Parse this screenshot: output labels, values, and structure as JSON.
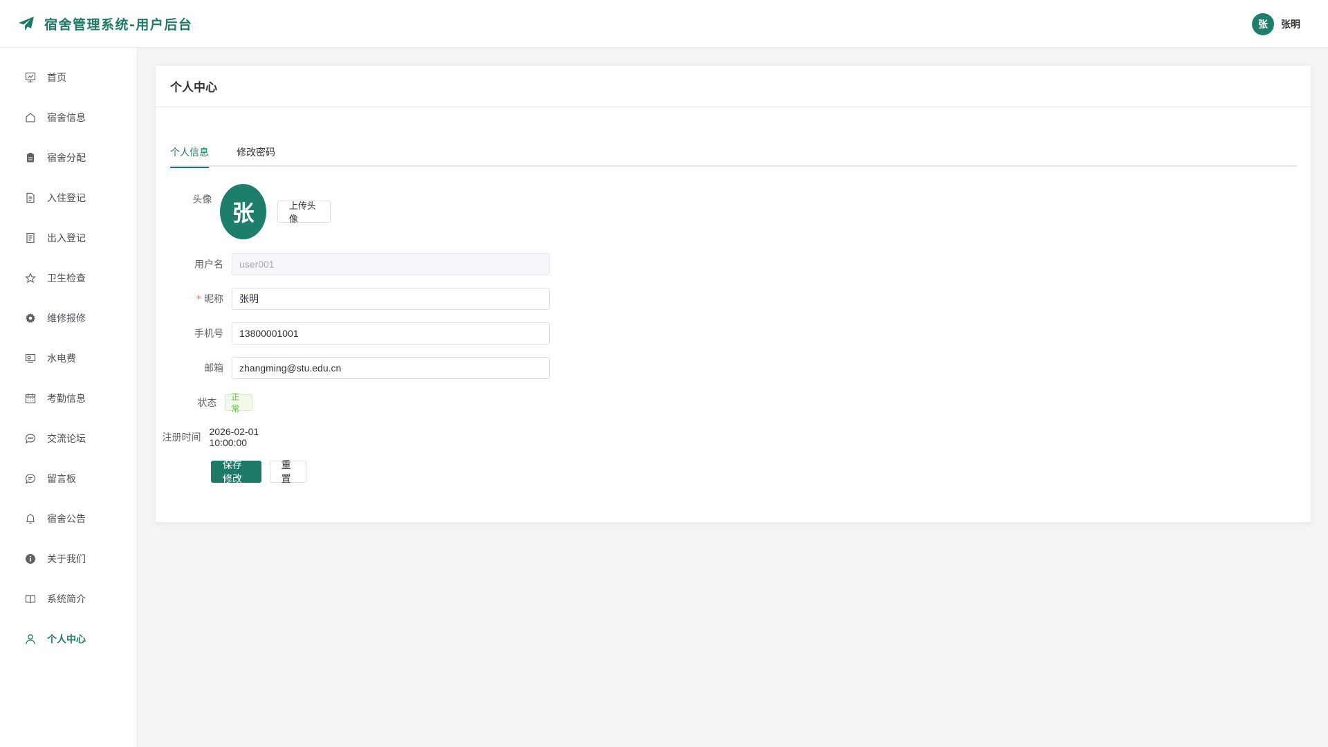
{
  "header": {
    "title": "宿舍管理系统-用户后台",
    "logo_icon": "paper-plane-icon",
    "user_avatar_char": "张",
    "user_name": "张明"
  },
  "sidebar": {
    "items": [
      {
        "label": "首页",
        "icon": "chart-icon"
      },
      {
        "label": "宿舍信息",
        "icon": "home-icon"
      },
      {
        "label": "宿舍分配",
        "icon": "clipboard-icon"
      },
      {
        "label": "入住登记",
        "icon": "document-icon"
      },
      {
        "label": "出入登记",
        "icon": "notes-icon"
      },
      {
        "label": "卫生检查",
        "icon": "star-icon"
      },
      {
        "label": "维修报修",
        "icon": "gear-icon"
      },
      {
        "label": "水电费",
        "icon": "money-icon"
      },
      {
        "label": "考勤信息",
        "icon": "calendar-icon"
      },
      {
        "label": "交流论坛",
        "icon": "chat-icon"
      },
      {
        "label": "留言板",
        "icon": "message-icon"
      },
      {
        "label": "宿舍公告",
        "icon": "bell-icon"
      },
      {
        "label": "关于我们",
        "icon": "info-icon"
      },
      {
        "label": "系统简介",
        "icon": "book-icon"
      },
      {
        "label": "个人中心",
        "icon": "user-icon",
        "active": true
      }
    ]
  },
  "main": {
    "card_title": "个人中心",
    "tabs": [
      {
        "label": "个人信息",
        "active": true
      },
      {
        "label": "修改密码",
        "active": false
      }
    ],
    "form": {
      "avatar_label": "头像",
      "avatar_char": "张",
      "upload_button": "上传头像",
      "username_label": "用户名",
      "username_value": "user001",
      "nickname_required": "*",
      "nickname_label": "昵称",
      "nickname_value": "张明",
      "phone_label": "手机号",
      "phone_value": "13800001001",
      "email_label": "邮箱",
      "email_value": "zhangming@stu.edu.cn",
      "status_label": "状态",
      "status_value": "正常",
      "register_label": "注册时间",
      "register_value": "2026-02-01 10:00:00",
      "save_button": "保存修改",
      "reset_button": "重置"
    }
  },
  "colors": {
    "primary": "#1d7a66",
    "success_tag": "#67c23a",
    "required": "#f56c6c"
  }
}
